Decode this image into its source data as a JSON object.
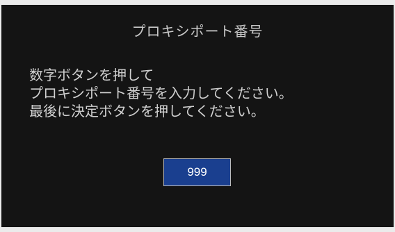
{
  "dialog": {
    "title": "プロキシポート番号",
    "instructions": [
      "数字ボタンを押して",
      "プロキシポート番号を入力してください。",
      "最後に決定ボタンを押してください。"
    ],
    "port_value": "999"
  },
  "colors": {
    "background": "#141414",
    "text": "#d0d0d0",
    "field_background": "#1a3f8f",
    "field_border": "#bdbdbd"
  }
}
